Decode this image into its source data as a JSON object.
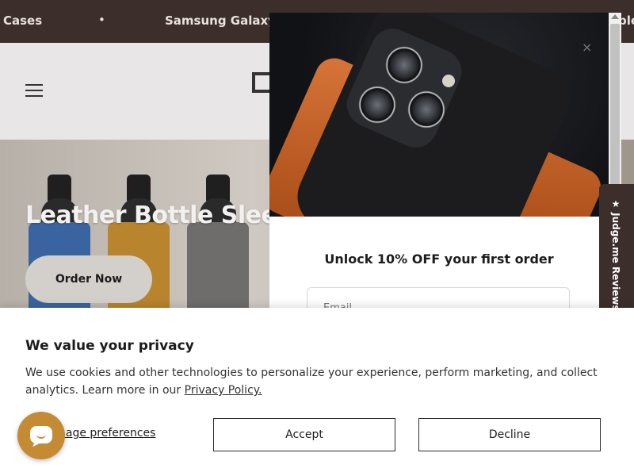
{
  "announcement": {
    "items": [
      "Cases",
      "Samsung Galaxy S",
      "ple"
    ],
    "separator": "•"
  },
  "header": {
    "menu_icon": "hamburger-menu-icon",
    "logo_icon": "brand-logo-icon"
  },
  "hero": {
    "title": "Leather Bottle Sleeve",
    "cta_label": "Order Now",
    "sleeve_colors": [
      "#3a64a0",
      "#b8842e",
      "#6e6d6b"
    ]
  },
  "popup": {
    "heading": "Unlock 10% OFF your first order",
    "email_placeholder": "Email",
    "close_symbol": "×",
    "image_icon": "leather-phone-case-image"
  },
  "judgeme": {
    "label": "★ Judge.me Reviews"
  },
  "cookie_banner": {
    "title": "We value your privacy",
    "text": "We use cookies and other technologies to personalize your experience, perform marketing, and collect analytics. Learn more in our ",
    "link_label": "Privacy Policy.",
    "manage_label": "nage preferences",
    "accept_label": "Accept",
    "decline_label": "Decline"
  },
  "chat": {
    "icon": "chat-bubble-icon",
    "color": "#c48a34"
  },
  "colors": {
    "announcement_bg": "#3b2e2b",
    "header_bg": "#e8e6e6"
  }
}
